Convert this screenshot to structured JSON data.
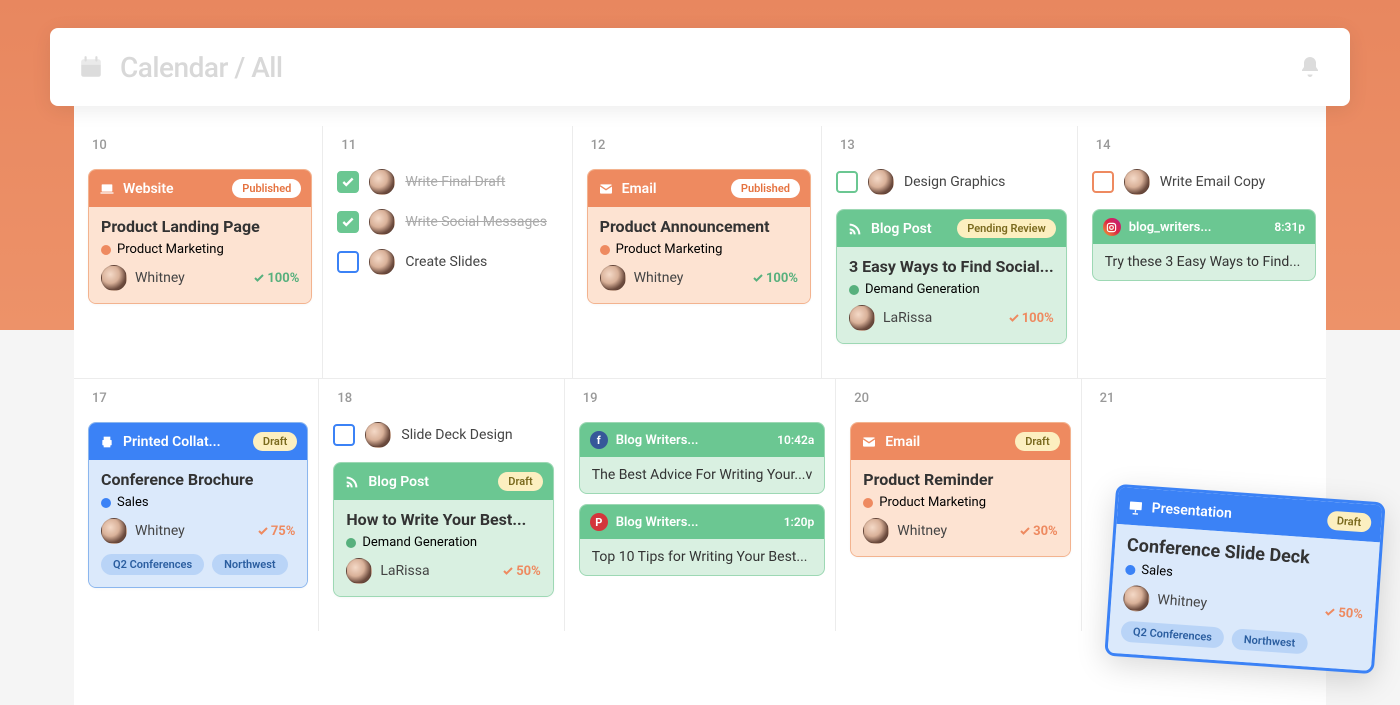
{
  "header": {
    "title": "Calendar / All"
  },
  "colors": {
    "orange": "#ee8a60",
    "green": "#6bc792",
    "blue": "#3b82f6",
    "tag_orange": "#ee8a60",
    "tag_green": "#57b07d",
    "tag_blue": "#3b82f6"
  },
  "badges": {
    "published": "Published",
    "draft": "Draft",
    "pending": "Pending Review"
  },
  "days": {
    "d10": {
      "num": "10",
      "card": {
        "type_label": "Website",
        "badge": "published",
        "title": "Product Landing Page",
        "tag": "Product Marketing",
        "tag_dot": "tag_orange",
        "owner": "Whitney",
        "pct": "100%",
        "pct_color": "#57b07d"
      }
    },
    "d11": {
      "num": "11",
      "tasks": [
        {
          "done": true,
          "label": "Write Final Draft"
        },
        {
          "done": true,
          "label": "Write Social Messages"
        },
        {
          "done": false,
          "chk": "blue-outline",
          "label": "Create Slides"
        }
      ]
    },
    "d12": {
      "num": "12",
      "card": {
        "type_label": "Email",
        "badge": "published",
        "title": "Product Announcement",
        "tag": "Product Marketing",
        "tag_dot": "tag_orange",
        "owner": "Whitney",
        "pct": "100%",
        "pct_color": "#57b07d"
      }
    },
    "d13": {
      "num": "13",
      "tasks": [
        {
          "done": false,
          "chk": "green-outline",
          "label": "Design Graphics"
        }
      ],
      "card": {
        "type_label": "Blog Post",
        "badge": "pending",
        "title": "3 Easy Ways to Find Social...",
        "tag": "Demand Generation",
        "tag_dot": "tag_green",
        "owner": "LaRissa",
        "pct": "100%",
        "pct_color": "#ee8a60"
      }
    },
    "d14": {
      "num": "14",
      "tasks": [
        {
          "done": false,
          "chk": "orange-outline",
          "label": "Write Email Copy"
        }
      ],
      "social": {
        "icon": "ig",
        "account": "blog_writers...",
        "time": "8:31p",
        "text": "Try these 3 Easy Ways to Find..."
      }
    },
    "d17": {
      "num": "17",
      "card": {
        "type_label": "Printed Collat...",
        "badge": "draft",
        "title": "Conference Brochure",
        "tag": "Sales",
        "tag_dot": "tag_blue",
        "owner": "Whitney",
        "pct": "75%",
        "pct_color": "#ee8a60",
        "pills": [
          "Q2 Conferences",
          "Northwest"
        ]
      }
    },
    "d18": {
      "num": "18",
      "tasks": [
        {
          "done": false,
          "chk": "blue-outline",
          "label": "Slide Deck Design"
        }
      ],
      "card": {
        "type_label": "Blog Post",
        "badge": "draft",
        "title": "How to Write Your Best...",
        "tag": "Demand Generation",
        "tag_dot": "tag_green",
        "owner": "LaRissa",
        "pct": "50%",
        "pct_color": "#ee8a60"
      }
    },
    "d19": {
      "num": "19",
      "socials": [
        {
          "icon": "fb",
          "account": "Blog Writers...",
          "time": "10:42a",
          "text": "The Best Advice For Writing Your...v"
        },
        {
          "icon": "pin",
          "account": "Blog Writers...",
          "time": "1:20p",
          "text": "Top 10 Tips for Writing Your Best..."
        }
      ]
    },
    "d20": {
      "num": "20",
      "card": {
        "type_label": "Email",
        "badge": "draft",
        "title": "Product Reminder",
        "tag": "Product Marketing",
        "tag_dot": "tag_orange",
        "owner": "Whitney",
        "pct": "30%",
        "pct_color": "#ee8a60"
      }
    },
    "d21": {
      "num": "21"
    }
  },
  "floating": {
    "type_label": "Presentation",
    "badge": "draft",
    "title": "Conference Slide Deck",
    "tag": "Sales",
    "tag_dot": "tag_blue",
    "owner": "Whitney",
    "pct": "50%",
    "pct_color": "#ee8a60",
    "pills": [
      "Q2 Conferences",
      "Northwest"
    ]
  }
}
